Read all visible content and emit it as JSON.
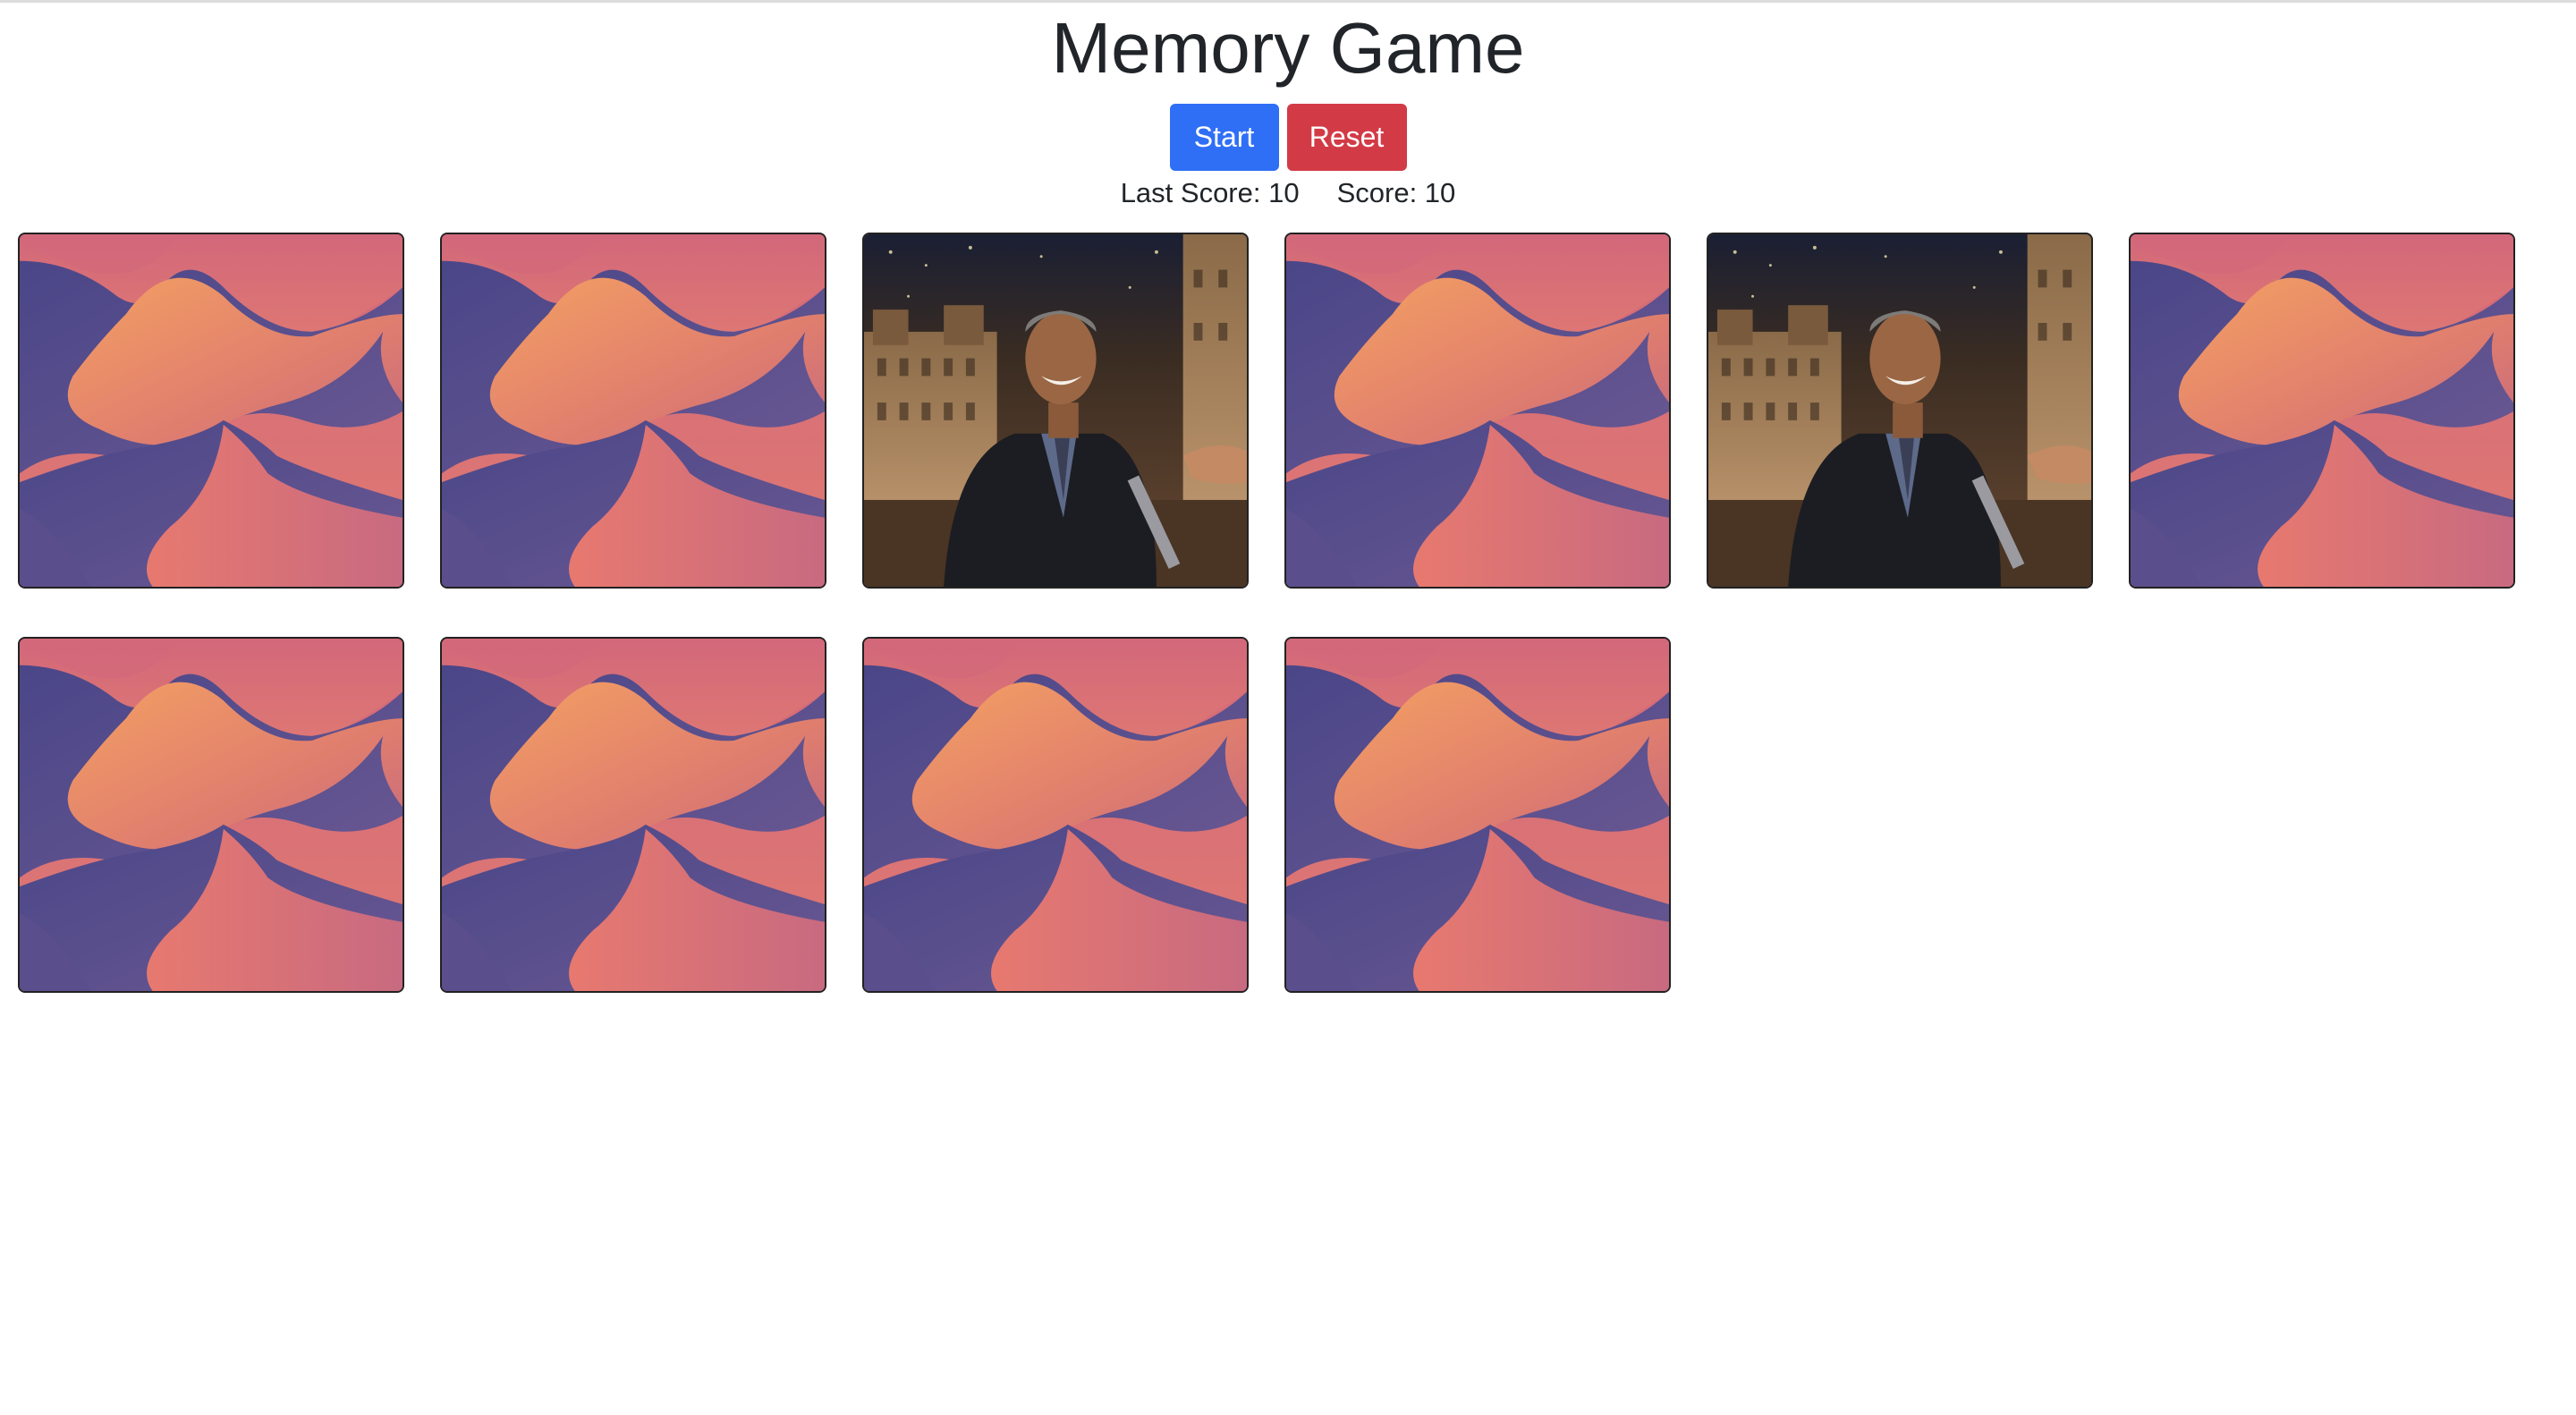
{
  "page": {
    "title": "Memory Game"
  },
  "controls": {
    "start_label": "Start",
    "reset_label": "Reset"
  },
  "scores": {
    "last_score_text": "Last Score: 10",
    "score_text": "Score: 10"
  },
  "colors": {
    "start_button": "#2f6ff5",
    "reset_button": "#d23b46",
    "card_back_sky": "#d96c79",
    "card_back_dune_dark": "#4f4a8a",
    "card_back_dune_orange": "#f09a62"
  },
  "board": {
    "cards": [
      {
        "state": "face-down",
        "image": "desert-dunes-card-back"
      },
      {
        "state": "face-down",
        "image": "desert-dunes-card-back"
      },
      {
        "state": "face-up",
        "image": "laughing-man-in-suit-photo"
      },
      {
        "state": "face-down",
        "image": "desert-dunes-card-back"
      },
      {
        "state": "face-up",
        "image": "laughing-man-in-suit-photo"
      },
      {
        "state": "face-down",
        "image": "desert-dunes-card-back"
      },
      {
        "state": "face-down",
        "image": "desert-dunes-card-back"
      },
      {
        "state": "face-down",
        "image": "desert-dunes-card-back"
      },
      {
        "state": "face-down",
        "image": "desert-dunes-card-back"
      },
      {
        "state": "face-down",
        "image": "desert-dunes-card-back"
      }
    ]
  }
}
